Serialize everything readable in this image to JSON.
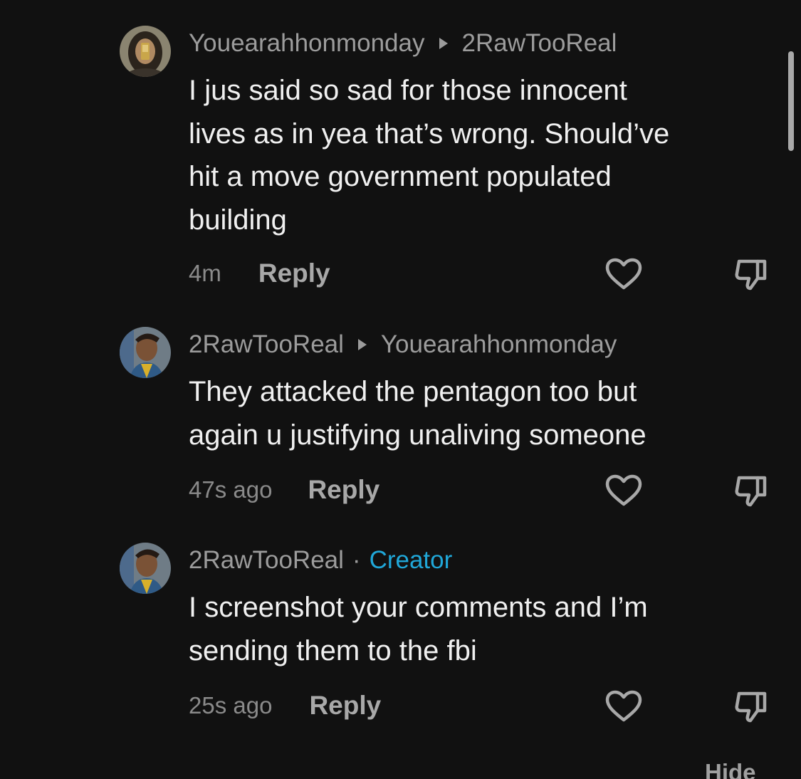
{
  "comments": [
    {
      "author": "Youearahhonmonday",
      "reply_to": "2RawTooReal",
      "text": "I jus said so sad for those innocent\nlives as in yea that’s wrong. Should’ve\nhit a move government populated\nbuilding",
      "time": "4m",
      "reply_label": "Reply"
    },
    {
      "author": "2RawTooReal",
      "reply_to": "Youearahhonmonday",
      "text": "They attacked the pentagon too but\nagain u justifying unaliving someone",
      "time": "47s ago",
      "reply_label": "Reply"
    },
    {
      "author": "2RawTooReal",
      "badge_separator": "·",
      "badge": "Creator",
      "text": "I screenshot your comments and I’m\nsending them to the fbi",
      "time": "25s ago",
      "reply_label": "Reply"
    }
  ],
  "hide_label": "Hide",
  "colors": {
    "background": "#111111",
    "creator_badge": "#20a7d8",
    "muted_text": "#9c9c9c"
  }
}
